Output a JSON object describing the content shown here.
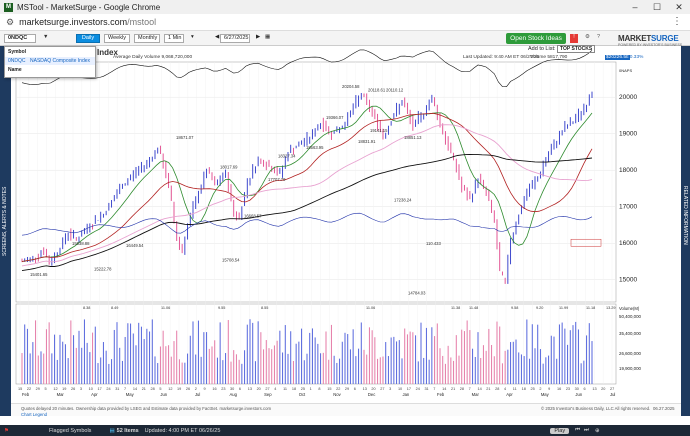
{
  "window": {
    "title": "MSTool - MarketSurge - Google Chrome"
  },
  "address": {
    "domain": "marketsurge.investors.com",
    "path": "/mstool"
  },
  "toolbar": {
    "symbol_value": "0NDQC",
    "periods": [
      "Daily",
      "Weekly",
      "Monthly",
      "1 Min"
    ],
    "date_value": "6/27/2025",
    "stock_ideas_label": "Open Stock Ideas",
    "add_to_list_label": "Add to List:",
    "top_stocks_label": "TOP STOCKS"
  },
  "logo": {
    "brand_a": "MARKET",
    "brand_b": "SURGE",
    "tagline": "POWERED BY INVESTOR'S BUSINESS DAILY"
  },
  "dropdown": {
    "header": "Symbol",
    "symbol": "0NDQC",
    "name": "NASDAQ Composite Index",
    "name_label": "Name"
  },
  "chart_header": {
    "title_fragment": "Index",
    "avg_volume": "Average Daily Volume 9,068,720,000",
    "last_updated": "Last Updated: 9:40 AM ET 06/27/25",
    "volume_readout": "Volume 5817,790",
    "price_readout": "$20226.58",
    "pct_readout": "+0.33%"
  },
  "rails": {
    "left": "SCREENS, ALERTS & NOTES",
    "right": "RELATED INFORMATION"
  },
  "chart_data": {
    "type": "line",
    "title": "",
    "price_axis_ticks": [
      15000,
      16000,
      17000,
      18000,
      19000,
      20000
    ],
    "volume_axis_ticks": [
      "50,400,000",
      "35,400,000",
      "26,600,000",
      "19,900,000"
    ],
    "volume_axis_label": "Volume(M)",
    "x_months": [
      "Feb",
      "Mar",
      "Apr",
      "May",
      "Jun",
      "Jul",
      "Aug",
      "Sep",
      "Oct",
      "Nov",
      "Dec",
      "Jan",
      "Feb",
      "Mar",
      "Apr",
      "May",
      "Jun",
      "Jul"
    ],
    "x_day_ticks": [
      "15",
      "22",
      "29",
      "5",
      "12",
      "19",
      "26",
      "3",
      "10",
      "17",
      "24",
      "31",
      "7",
      "14",
      "21",
      "28",
      "5",
      "12",
      "19",
      "26",
      "2",
      "9",
      "16",
      "23",
      "30",
      "6",
      "13",
      "20",
      "27",
      "4",
      "11",
      "18",
      "25",
      "1",
      "8",
      "15",
      "22",
      "29",
      "6",
      "13",
      "20",
      "27",
      "3",
      "10",
      "17",
      "24",
      "31",
      "7",
      "14",
      "21",
      "28",
      "7",
      "14",
      "21",
      "28",
      "4",
      "11",
      "18",
      "25",
      "2",
      "9",
      "16",
      "23",
      "30",
      "6",
      "13",
      "20",
      "27"
    ],
    "price_labels": [
      {
        "text": "15401.65"
      },
      {
        "text": "15538.88"
      },
      {
        "text": "15222.78"
      },
      {
        "text": "16449.54"
      },
      {
        "text": "18671.07"
      },
      {
        "text": "15708.54"
      },
      {
        "text": "18017.69"
      },
      {
        "text": "16668.57"
      },
      {
        "text": "18327.34"
      },
      {
        "text": "17707.79"
      },
      {
        "text": "18563.95"
      },
      {
        "text": "19366.07"
      },
      {
        "text": "20204.58"
      },
      {
        "text": "18831.91"
      },
      {
        "text": "20118.61"
      },
      {
        "text": "19141.15"
      },
      {
        "text": "20110.12"
      },
      {
        "text": "18851.13"
      },
      {
        "text": "17238.24"
      },
      {
        "text": "14784.03"
      },
      {
        "text": "110.433"
      }
    ],
    "volume_labels": [
      {
        "text": "8.38"
      },
      {
        "text": "8.49"
      },
      {
        "text": "11.06"
      },
      {
        "text": "9.55"
      },
      {
        "text": "8.55"
      },
      {
        "text": "11.06"
      },
      {
        "text": "11.38"
      },
      {
        "text": "11.48"
      },
      {
        "text": "9.58"
      },
      {
        "text": "9.20"
      },
      {
        "text": "11.99"
      },
      {
        "text": "11.18"
      },
      {
        "text": "13.29"
      }
    ],
    "right_tags": [
      "0NAPS"
    ],
    "series": [
      {
        "name": "",
        "color": "#1a1aa6"
      },
      {
        "name": "",
        "color": "#2e8b2e"
      },
      {
        "name": "",
        "color": "#b22222"
      },
      {
        "name": "",
        "color": "#111111"
      },
      {
        "name": "",
        "color": "#2233aa"
      },
      {
        "name": "",
        "color": "#111111"
      }
    ]
  },
  "footer": {
    "left": "Quotes delayed 20 minutes. Ownership data provided by LSEG and Estimate data provided by FactSet. marketsurge.investors.com",
    "legend_link": "Chart Legend",
    "right": "© 2025 Investor's Business Daily, LLC All rights reserved.",
    "date": "06.27.2025"
  },
  "taskbar": {
    "flagged": "Flagged Symbols",
    "lists": "52 Items",
    "updated": "Updated: 4:00 PM ET 06/26/25",
    "play": "Play"
  }
}
